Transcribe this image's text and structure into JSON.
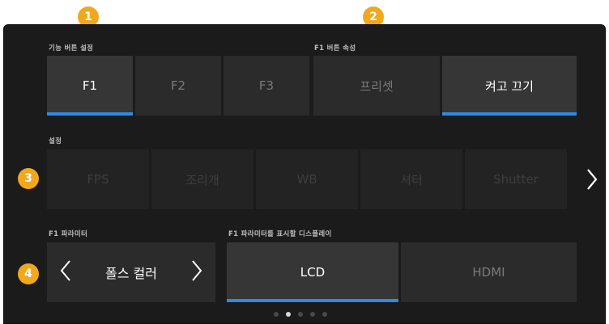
{
  "callouts": [
    "1",
    "2",
    "3",
    "4"
  ],
  "function_buttons": {
    "label": "기능 버튼 설정",
    "items": [
      "F1",
      "F2",
      "F3"
    ],
    "selected": "F1"
  },
  "button_behavior": {
    "label": "F1 버튼 속성",
    "items": [
      "프리셋",
      "켜고 끄기"
    ],
    "selected": "켜고 끄기"
  },
  "settings": {
    "label": "설정",
    "items": [
      "FPS",
      "조리개",
      "WB",
      "셔터",
      "Shutter"
    ],
    "next_icon": "chevron-right-icon"
  },
  "parameter": {
    "label": "F1 파라미터",
    "value": "폴스 컬러",
    "prev_icon": "chevron-left-icon",
    "next_icon": "chevron-right-icon"
  },
  "display": {
    "label": "F1 파라미터를 표시할 디스플레이",
    "items": [
      "LCD",
      "HDMI"
    ],
    "selected": "LCD"
  },
  "pagination": {
    "pages": 5,
    "current": 2
  },
  "colors": {
    "accent": "#2d8be6",
    "callout": "#f2a81d",
    "panel": "#1b1b1b"
  }
}
